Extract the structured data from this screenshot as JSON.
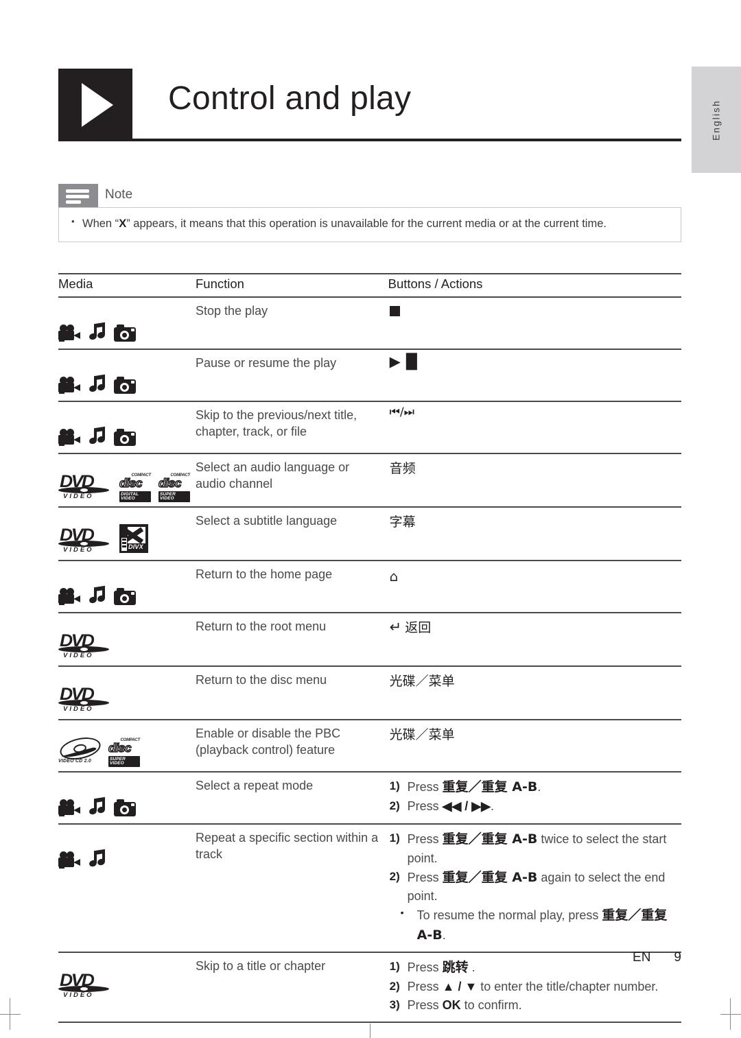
{
  "side_tab": {
    "label": "English"
  },
  "header": {
    "title": "Control and play",
    "icon": "play-triangle-icon"
  },
  "note": {
    "label": "Note",
    "icon": "note-lines-icon",
    "items": [
      {
        "pre": "When “",
        "kw": "X",
        "post": "” appears, it means that this operation is unavailable for the current media or at the current time."
      }
    ]
  },
  "table": {
    "headers": {
      "media": "Media",
      "function": "Function",
      "buttons": "Buttons / Actions"
    },
    "rows": [
      {
        "media_icons": [
          "camcorder-icon",
          "music-note-icon",
          "photo-camera-icon"
        ],
        "function": "Stop the play",
        "buttons_glyph": "stop-square",
        "buttons_text": ""
      },
      {
        "media_icons": [
          "camcorder-icon",
          "music-note-icon",
          "photo-camera-icon"
        ],
        "function": "Pause or resume the play",
        "buttons_glyph": "play-pause",
        "buttons_text": "▶▐▌"
      },
      {
        "media_icons": [
          "camcorder-icon",
          "music-note-icon",
          "photo-camera-icon"
        ],
        "function": "Skip to the previous/next title, chapter, track, or file",
        "buttons_glyph": "prev-next",
        "buttons_text": "⏮/⏭"
      },
      {
        "media_icons": [
          "dvd-video-logo",
          "compact-disc-digital-video-logo",
          "compact-disc-super-video-logo"
        ],
        "function": "Select an audio language or audio channel",
        "buttons_glyph": "",
        "buttons_text": "音频"
      },
      {
        "media_icons": [
          "dvd-video-logo",
          "divx-logo"
        ],
        "function": "Select a subtitle language",
        "buttons_glyph": "",
        "buttons_text": "字幕"
      },
      {
        "media_icons": [
          "camcorder-icon",
          "music-note-icon",
          "photo-camera-icon"
        ],
        "function": "Return to the home page",
        "buttons_glyph": "home",
        "buttons_text": "⌂"
      },
      {
        "media_icons": [
          "dvd-video-logo"
        ],
        "function": "Return to the root menu",
        "buttons_glyph": "back-arrow",
        "buttons_text": "返回"
      },
      {
        "media_icons": [
          "dvd-video-logo"
        ],
        "function": "Return to the disc menu",
        "buttons_glyph": "",
        "buttons_text": "光碟／菜单"
      },
      {
        "media_icons": [
          "video-cd-logo",
          "compact-disc-super-video-logo"
        ],
        "function": "Enable or disable the PBC (playback control) feature",
        "buttons_glyph": "",
        "buttons_text": "光碟／菜单"
      },
      {
        "media_icons": [
          "camcorder-icon",
          "music-note-icon",
          "photo-camera-icon"
        ],
        "function": "Select a repeat mode",
        "steps": [
          {
            "num": "1)",
            "pre": "Press ",
            "kw": "重复／重复 A-B",
            "post": "."
          },
          {
            "num": "2)",
            "pre": "Press ",
            "kw": "◀◀ / ▶▶",
            "post": "."
          }
        ]
      },
      {
        "media_icons": [
          "camcorder-icon",
          "music-note-icon"
        ],
        "function": "Repeat a specific section within a track",
        "steps": [
          {
            "num": "1)",
            "pre": "Press ",
            "kw": "重复／重复 A-B",
            "post": " twice to select the start point."
          },
          {
            "num": "2)",
            "pre": "Press ",
            "kw": "重复／重复 A-B",
            "post": " again to select the end point."
          },
          {
            "num": "•",
            "bulleted": true,
            "pre": "To resume the normal play, press ",
            "kw": "重复／重复 A-B",
            "post": "."
          }
        ]
      },
      {
        "media_icons": [
          "dvd-video-logo"
        ],
        "function": "Skip to a title or chapter",
        "steps": [
          {
            "num": "1)",
            "pre": "Press ",
            "kw": "跳转",
            "post": " ."
          },
          {
            "num": "2)",
            "pre": "Press ",
            "kw": "▲ / ▼",
            "post": " to enter the title/chapter number."
          },
          {
            "num": "3)",
            "pre": "Press ",
            "kw": "OK",
            "post": " to confirm."
          }
        ]
      }
    ]
  },
  "logos": {
    "dvd": {
      "word": "DVD",
      "sub": "VIDEO"
    },
    "cd_digital_video": {
      "top": "COMPACT",
      "word": "disc",
      "sub": "DIGITAL VIDEO"
    },
    "cd_super_video": {
      "top": "COMPACT",
      "word": "disc",
      "sub": "SUPER VIDEO"
    },
    "divx": {
      "word": "DIVX"
    },
    "video_cd": {
      "sub": "VIDEO CD 2.0"
    }
  },
  "footer": {
    "lang_code": "EN",
    "page_number": "9"
  }
}
